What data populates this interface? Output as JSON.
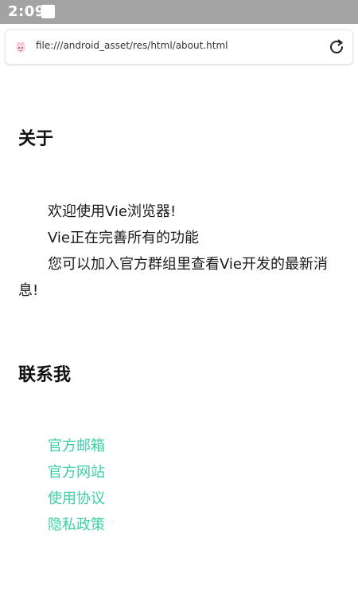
{
  "status_bar": {
    "time": "2:09"
  },
  "address_bar": {
    "url": "file:///android_asset/res/html/about.html",
    "favicon": "vie-logo-icon",
    "reload_icon": "reload-icon"
  },
  "about": {
    "heading": "关于",
    "paragraphs": [
      "欢迎使用Vie浏览器!",
      "Vie正在完善所有的功能",
      "您可以加入官方群组里查看Vie开发的最新消息!"
    ]
  },
  "contact": {
    "heading": "联系我",
    "links": [
      "官方邮箱",
      "官方网站",
      "使用协议",
      "隐私政策"
    ]
  },
  "colors": {
    "link": "#3ccfa6",
    "status_bar_bg": "#a3a3a3"
  }
}
